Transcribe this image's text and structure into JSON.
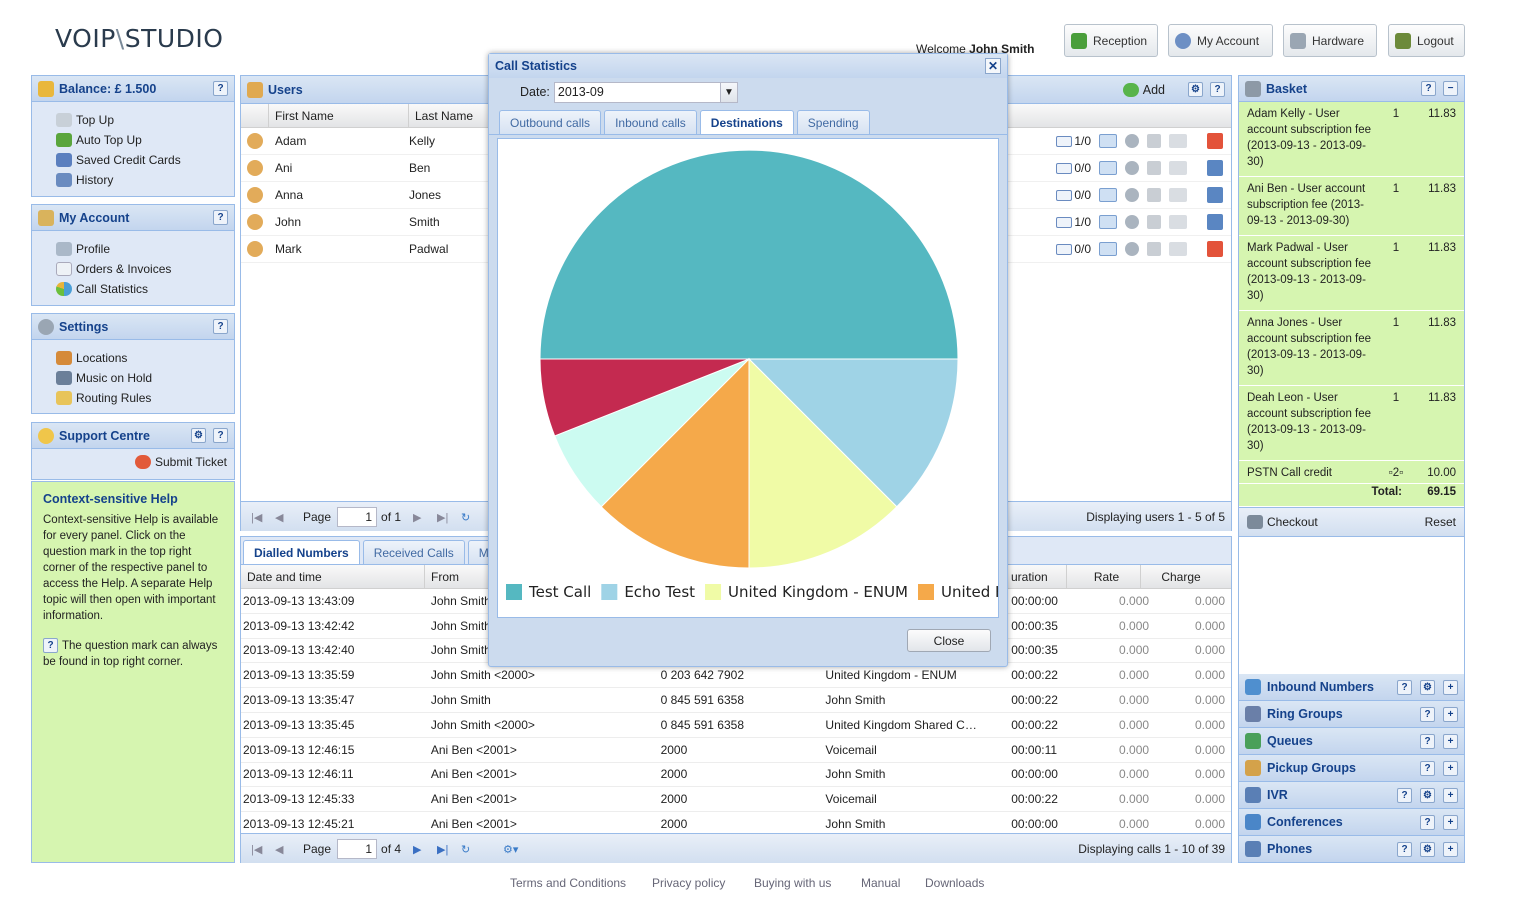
{
  "header": {
    "logo_left": "VOIP",
    "logo_sep": "\\",
    "logo_right": "STUDIO",
    "welcome_prefix": "Welcome",
    "welcome_user": "John Smith",
    "buttons": [
      {
        "label": "Reception"
      },
      {
        "label": "My Account"
      },
      {
        "label": "Hardware"
      },
      {
        "label": "Logout"
      }
    ]
  },
  "left": {
    "balance": {
      "title": "Balance: £ 1.500",
      "items": [
        "Top Up",
        "Auto Top Up",
        "Saved Credit Cards",
        "History"
      ]
    },
    "account": {
      "title": "My Account",
      "items": [
        "Profile",
        "Orders & Invoices",
        "Call Statistics"
      ]
    },
    "settings": {
      "title": "Settings",
      "items": [
        "Locations",
        "Music on Hold",
        "Routing Rules"
      ]
    },
    "support": {
      "title": "Support Centre",
      "submit": "Submit Ticket"
    },
    "help": {
      "title": "Context-sensitive Help",
      "body": "Context-sensitive Help is available for every panel. Click on the question mark in the top right corner of the respective panel to access the Help. A separate Help topic will then open with important information.",
      "body2": "The question mark can always be found in top right corner."
    }
  },
  "users": {
    "title": "Users",
    "add": "Add",
    "col_first": "First Name",
    "col_last": "Last Name",
    "rows": [
      {
        "first": "Adam",
        "last": "Kelly",
        "msg": "1/0"
      },
      {
        "first": "Ani",
        "last": "Ben",
        "msg": "0/0"
      },
      {
        "first": "Anna",
        "last": "Jones",
        "msg": "0/0"
      },
      {
        "first": "John",
        "last": "Smith",
        "msg": "1/0"
      },
      {
        "first": "Mark",
        "last": "Padwal",
        "msg": "0/0"
      }
    ],
    "page_label": "Page",
    "page_value": "1",
    "page_of": "of 1",
    "display": "Displaying users 1 - 5 of 5"
  },
  "calls": {
    "tabs": [
      "Dialled Numbers",
      "Received Calls",
      "M"
    ],
    "headers": {
      "date": "Date and time",
      "from": "From",
      "duration": "uration",
      "rate": "Rate",
      "charge": "Charge"
    },
    "rows": [
      {
        "date": "2013-09-13 13:43:09",
        "from": "John Smith",
        "number": "",
        "dest": "",
        "dur": "00:00:00",
        "rate": "0.000",
        "charge": "0.000"
      },
      {
        "date": "2013-09-13 13:42:42",
        "from": "John Smith",
        "number": "",
        "dest": "",
        "dur": "00:00:35",
        "rate": "0.000",
        "charge": "0.000"
      },
      {
        "date": "2013-09-13 13:42:40",
        "from": "John Smith",
        "number": "",
        "dest": "",
        "dur": "00:00:35",
        "rate": "0.000",
        "charge": "0.000"
      },
      {
        "date": "2013-09-13 13:35:59",
        "from": "John Smith <2000>",
        "number": "0 203 642 7902",
        "dest": "United Kingdom - ENUM",
        "dur": "00:00:22",
        "rate": "0.000",
        "charge": "0.000"
      },
      {
        "date": "2013-09-13 13:35:47",
        "from": "John Smith",
        "number": "0 845 591 6358",
        "dest": "John Smith",
        "dur": "00:00:22",
        "rate": "0.000",
        "charge": "0.000"
      },
      {
        "date": "2013-09-13 13:35:45",
        "from": "John Smith <2000>",
        "number": "0 845 591 6358",
        "dest": "United Kingdom Shared C…",
        "dur": "00:00:22",
        "rate": "0.000",
        "charge": "0.000"
      },
      {
        "date": "2013-09-13 12:46:15",
        "from": "Ani Ben <2001>",
        "number": "2000",
        "dest": "Voicemail",
        "dur": "00:00:11",
        "rate": "0.000",
        "charge": "0.000"
      },
      {
        "date": "2013-09-13 12:46:11",
        "from": "Ani Ben <2001>",
        "number": "2000",
        "dest": "John Smith",
        "dur": "00:00:00",
        "rate": "0.000",
        "charge": "0.000"
      },
      {
        "date": "2013-09-13 12:45:33",
        "from": "Ani Ben <2001>",
        "number": "2000",
        "dest": "Voicemail",
        "dur": "00:00:22",
        "rate": "0.000",
        "charge": "0.000"
      },
      {
        "date": "2013-09-13 12:45:21",
        "from": "Ani Ben <2001>",
        "number": "2000",
        "dest": "John Smith",
        "dur": "00:00:00",
        "rate": "0.000",
        "charge": "0.000"
      }
    ],
    "page_label": "Page",
    "page_value": "1",
    "page_of": "of 4",
    "display": "Displaying calls 1 - 10 of 39"
  },
  "basket": {
    "title": "Basket",
    "items": [
      {
        "desc": "Adam Kelly - User account subscription fee (2013-09-13 - 2013-09-30)",
        "qty": "1",
        "price": "11.83"
      },
      {
        "desc": "Ani Ben - User account subscription fee (2013-09-13 - 2013-09-30)",
        "qty": "1",
        "price": "11.83"
      },
      {
        "desc": "Mark Padwal - User account subscription fee (2013-09-13 - 2013-09-30)",
        "qty": "1",
        "price": "11.83"
      },
      {
        "desc": "Anna Jones - User account subscription fee (2013-09-13 - 2013-09-30)",
        "qty": "1",
        "price": "11.83"
      },
      {
        "desc": "Deah Leon - User account subscription fee (2013-09-13 - 2013-09-30)",
        "qty": "1",
        "price": "11.83"
      }
    ],
    "pstn": {
      "desc": "PSTN Call credit",
      "qty": "2",
      "price": "10.00"
    },
    "total_label": "Total:",
    "total": "69.15",
    "checkout": "Checkout",
    "reset": "Reset"
  },
  "right_panels": [
    "Inbound Numbers",
    "Ring Groups",
    "Queues",
    "Pickup Groups",
    "IVR",
    "Conferences",
    "Phones"
  ],
  "dialog": {
    "title": "Call Statistics",
    "date_label": "Date:",
    "date_value": "2013-09",
    "tabs": [
      "Outbound calls",
      "Inbound calls",
      "Destinations",
      "Spending"
    ],
    "close": "Close"
  },
  "chart_data": {
    "type": "pie",
    "series": [
      {
        "name": "Test Call",
        "value": 50,
        "color": "#55b8c1"
      },
      {
        "name": "Echo Test",
        "value": 12.5,
        "color": "#9fd3e6"
      },
      {
        "name": "United Kingdom - ENUM",
        "value": 12.5,
        "color": "#f0fba6"
      },
      {
        "name": "United K",
        "value": 12.5,
        "color": "#f5a94a"
      },
      {
        "name": "",
        "value": 6.5,
        "color": "#ccfbf1"
      },
      {
        "name": "",
        "value": 6,
        "color": "#c42a50"
      }
    ],
    "legend": "bottom"
  },
  "footer": [
    "Terms and Conditions",
    "Privacy policy",
    "Buying with us",
    "Manual",
    "Downloads"
  ]
}
